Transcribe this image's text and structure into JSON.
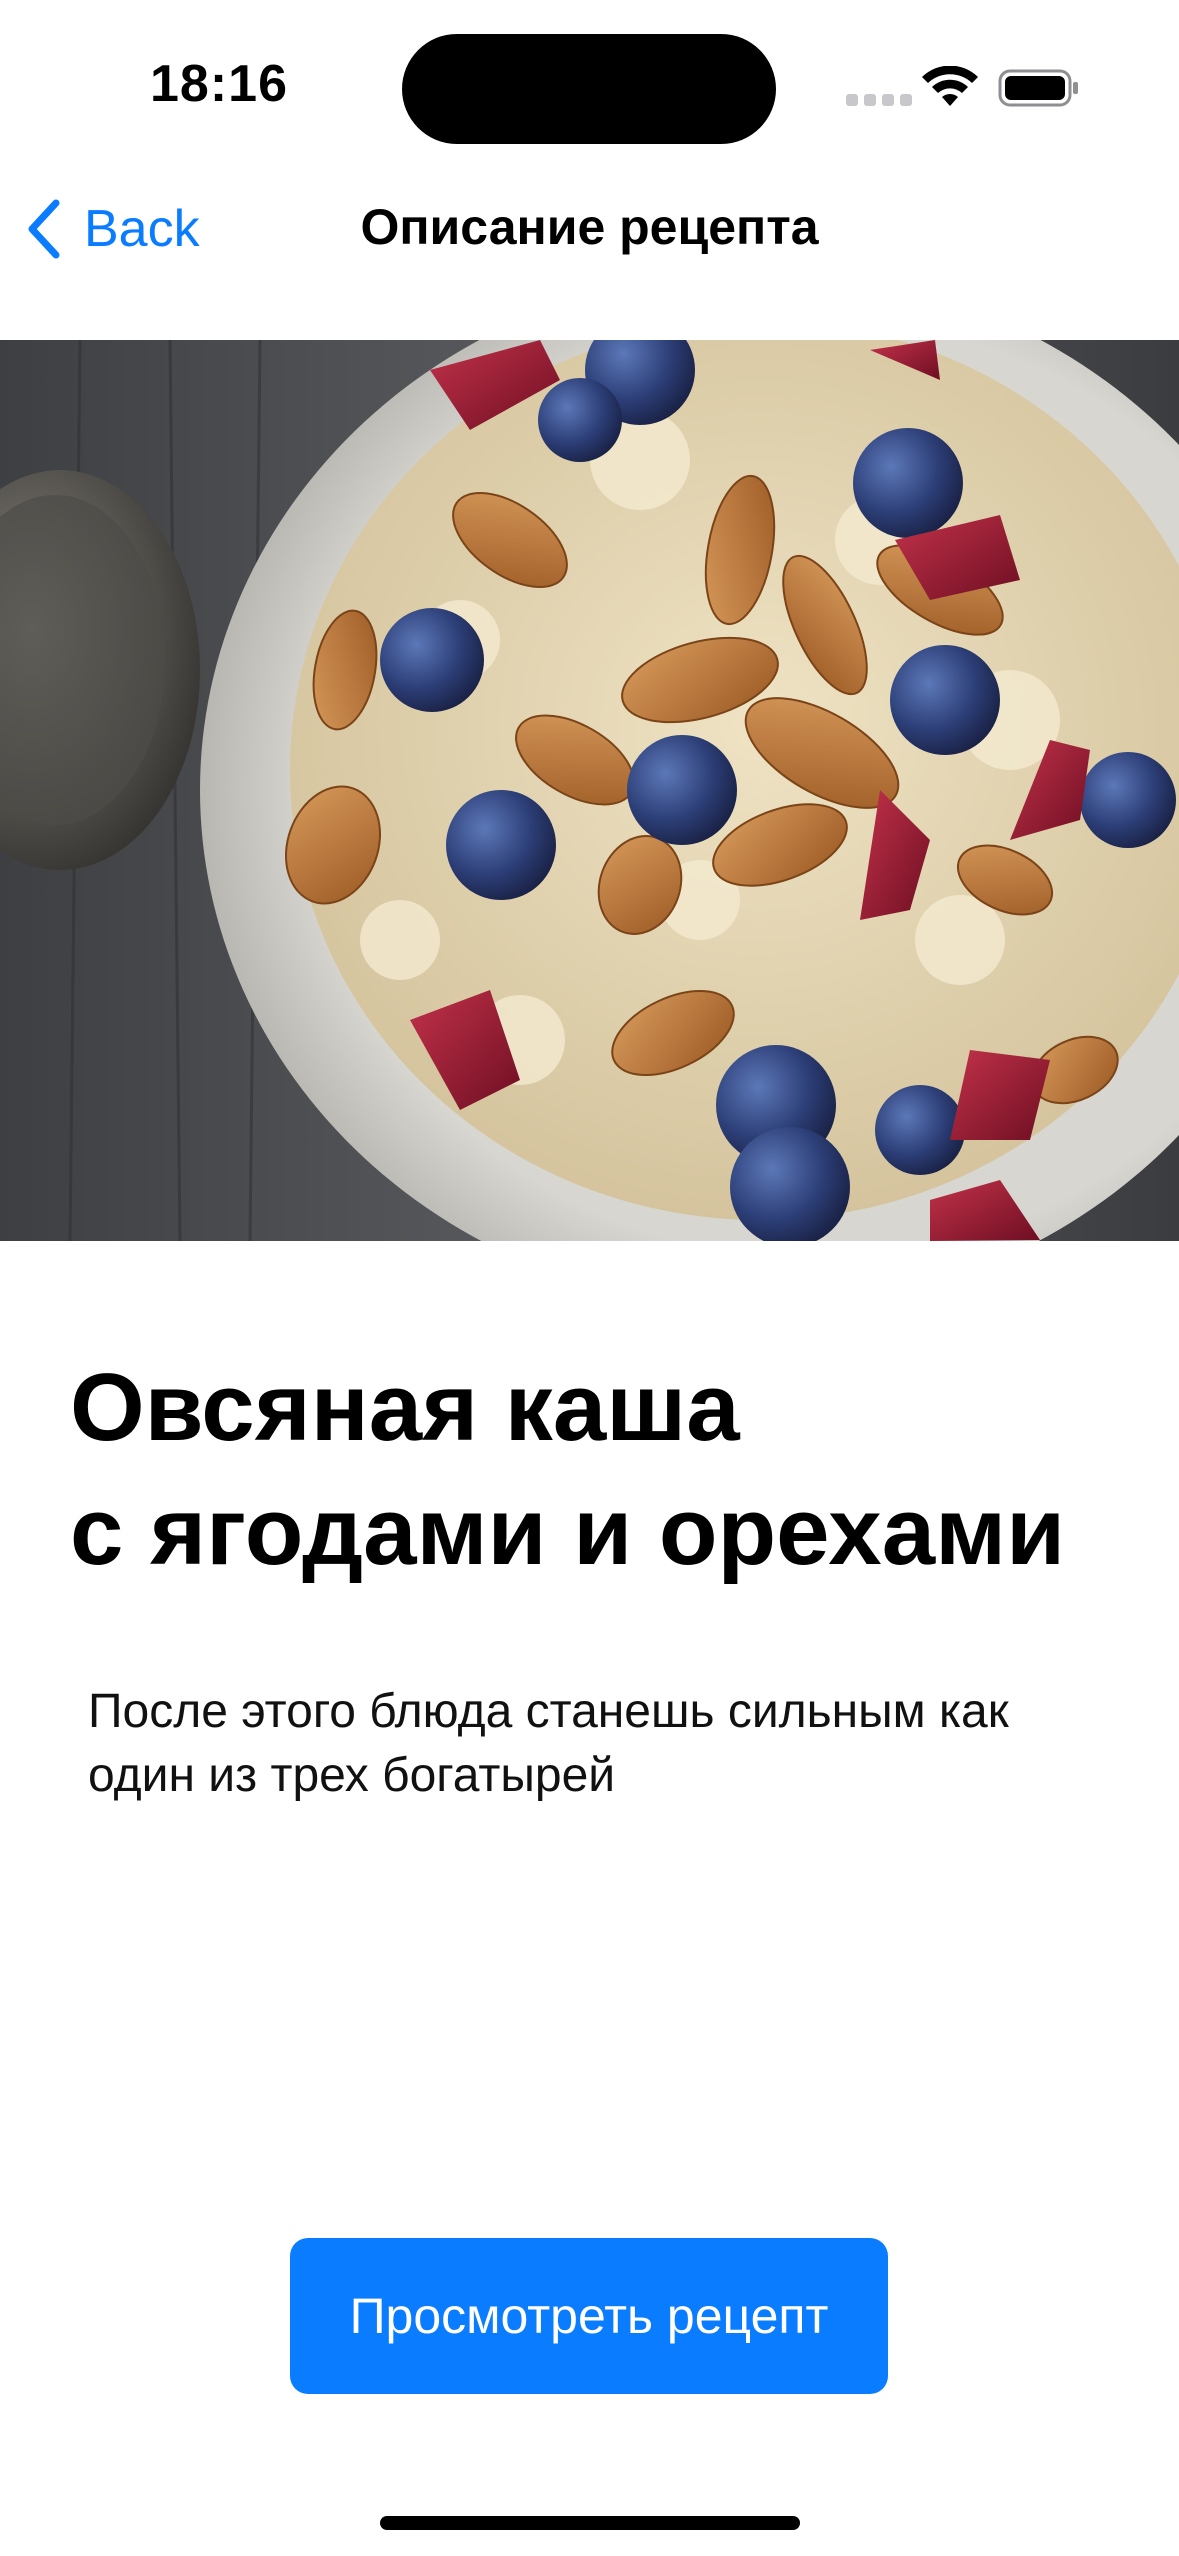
{
  "status_bar": {
    "time": "18:16"
  },
  "nav": {
    "back_label": "Back",
    "title": "Описание рецепта"
  },
  "hero": {
    "image_alt_icon": "oatmeal-photo"
  },
  "recipe": {
    "title_lines": [
      "Овсяная каша",
      "с ягодами и орехами"
    ],
    "description_lines": [
      "После этого блюда станешь сильным как",
      "один из трех богатырей"
    ]
  },
  "actions": {
    "view_recipe_label": "Просмотреть рецепт"
  },
  "colors": {
    "accent": "#0a7cff",
    "background": "#ffffff",
    "text": "#000000"
  }
}
